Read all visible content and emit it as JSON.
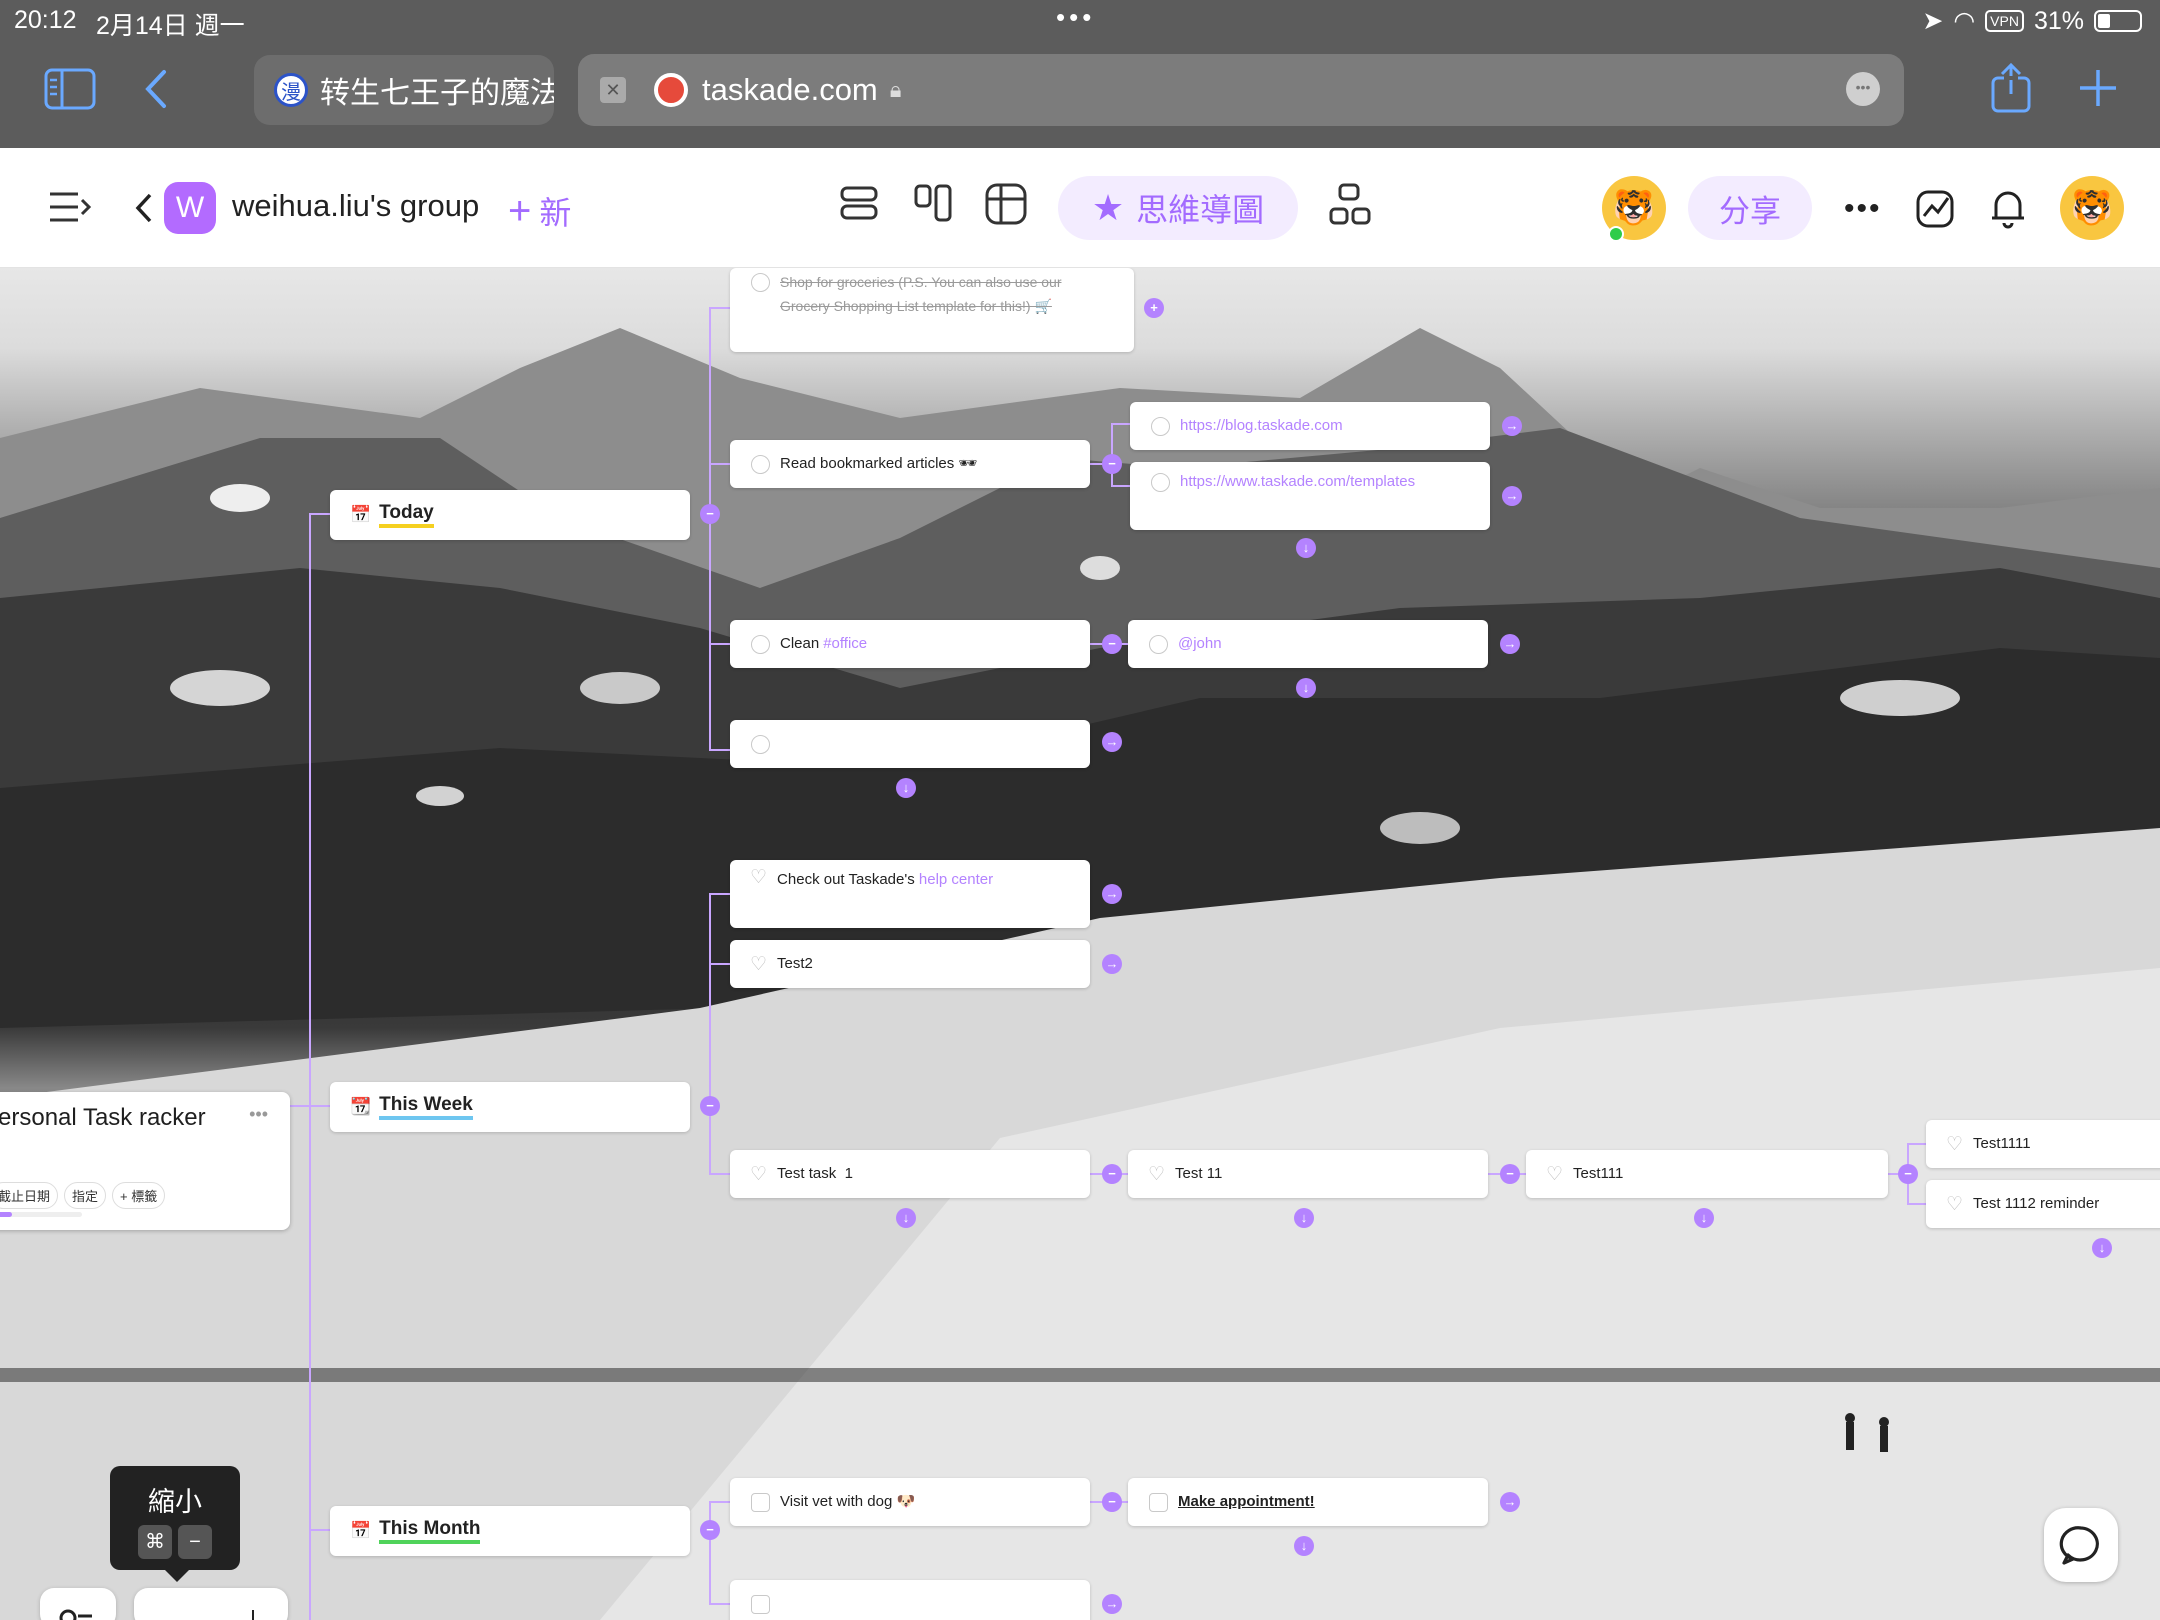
{
  "status_bar": {
    "time": "20:12",
    "date": "2月14日 週一",
    "vpn": "VPN",
    "battery": "31%",
    "dots": "•••"
  },
  "browser": {
    "tab_title": "转生七王子的魔法",
    "tab_favicon": "漫",
    "url": "taskade.com",
    "icons": {
      "sidebar": "sidebar-icon",
      "back": "back-icon",
      "share": "share-icon",
      "new_tab": "plus-icon"
    }
  },
  "app_bar": {
    "workspace_letter": "W",
    "workspace_name": "weihua.liu's group",
    "new_label": "新",
    "mindmap_label": "思維導圖",
    "share_label": "分享"
  },
  "mindmap": {
    "project": {
      "title": "ersonal Task racker",
      "chips": [
        "截止日期",
        "指定",
        "+ 標籤"
      ],
      "progress": 0.24
    },
    "sections": [
      {
        "icon": "📅",
        "icon_text": "17",
        "label": "Today",
        "underline": "#f5d020"
      },
      {
        "icon": "📆",
        "icon_text": "17",
        "label": "This Week",
        "underline": "#6ec6f0"
      },
      {
        "icon": "📅",
        "icon_text": "",
        "label": "This Month",
        "underline": "#50d35a"
      }
    ],
    "today_tasks": [
      {
        "text": "Shop for groceries (P.S. You can also use our Grocery Shopping List template for this!) 🛒",
        "done": true
      },
      {
        "text": "Read bookmarked articles 🕶",
        "done": false
      },
      {
        "prefix": "Clean ",
        "tag": "#office",
        "done": false
      },
      {
        "text": "",
        "done": false
      }
    ],
    "today_links": [
      "https://blog.taskade.com",
      "https://www.taskade.com/templates"
    ],
    "mention": "@john",
    "week_tasks": [
      {
        "prefix": "Check out Taskade's ",
        "link": "help center"
      },
      {
        "text": "Test2"
      },
      {
        "text": "Test task  1"
      }
    ],
    "week_chain": [
      "Test 11",
      "Test111"
    ],
    "week_leaves": [
      "Test1111",
      "Test 1112 reminder"
    ],
    "month_tasks": [
      {
        "text": "Visit vet with dog 🐶"
      },
      {
        "text": ""
      }
    ],
    "month_child": "Make appointment!"
  },
  "tooltip": {
    "label": "縮小",
    "keys": [
      "⌘",
      "−"
    ]
  },
  "colors": {
    "accent": "#b483ff",
    "line": "#c9a6ff"
  }
}
